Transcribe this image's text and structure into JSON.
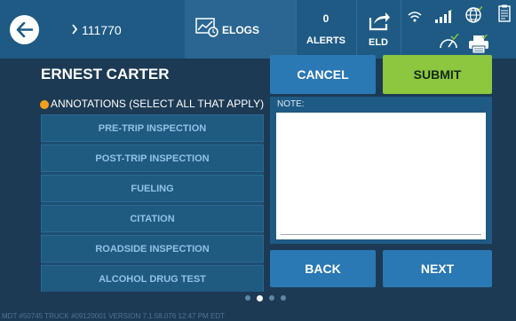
{
  "header": {
    "truck_id": "111770",
    "elogs_label": "ELOGS",
    "alerts_count": "0",
    "alerts_label": "ALERTS",
    "eld_label": "ELD",
    "icons": [
      "back-arrow-icon",
      "chevron-right-icon",
      "elogs-chart-icon",
      "share-export-icon",
      "wifi-icon",
      "signal-bars-icon",
      "globe-icon",
      "clipboard-icon",
      "gauge-icon",
      "printer-icon"
    ]
  },
  "driver": {
    "name": "ERNEST CARTER"
  },
  "annotations": {
    "heading": "ANNOTATIONS (SELECT ALL THAT APPLY)",
    "items": [
      "PRE-TRIP INSPECTION",
      "POST-TRIP INSPECTION",
      "FUELING",
      "CITATION",
      "ROADSIDE INSPECTION",
      "ALCOHOL DRUG TEST"
    ]
  },
  "actions": {
    "cancel": "CANCEL",
    "submit": "SUBMIT",
    "back": "BACK",
    "next": "NEXT"
  },
  "note": {
    "label": "NOTE:",
    "value": ""
  },
  "pager": {
    "pages": 4,
    "current": 2
  },
  "footer": {
    "text": "MDT #50745    TRUCK #09120001    VERSION  7.1.58.076    12:47 PM EDT"
  },
  "colors": {
    "header_bg": "#1e5a84",
    "body_bg": "#1c3a54",
    "submit_green": "#8dc63f",
    "button_blue": "#2a78b4",
    "alert_dot": "#f5a01a"
  }
}
